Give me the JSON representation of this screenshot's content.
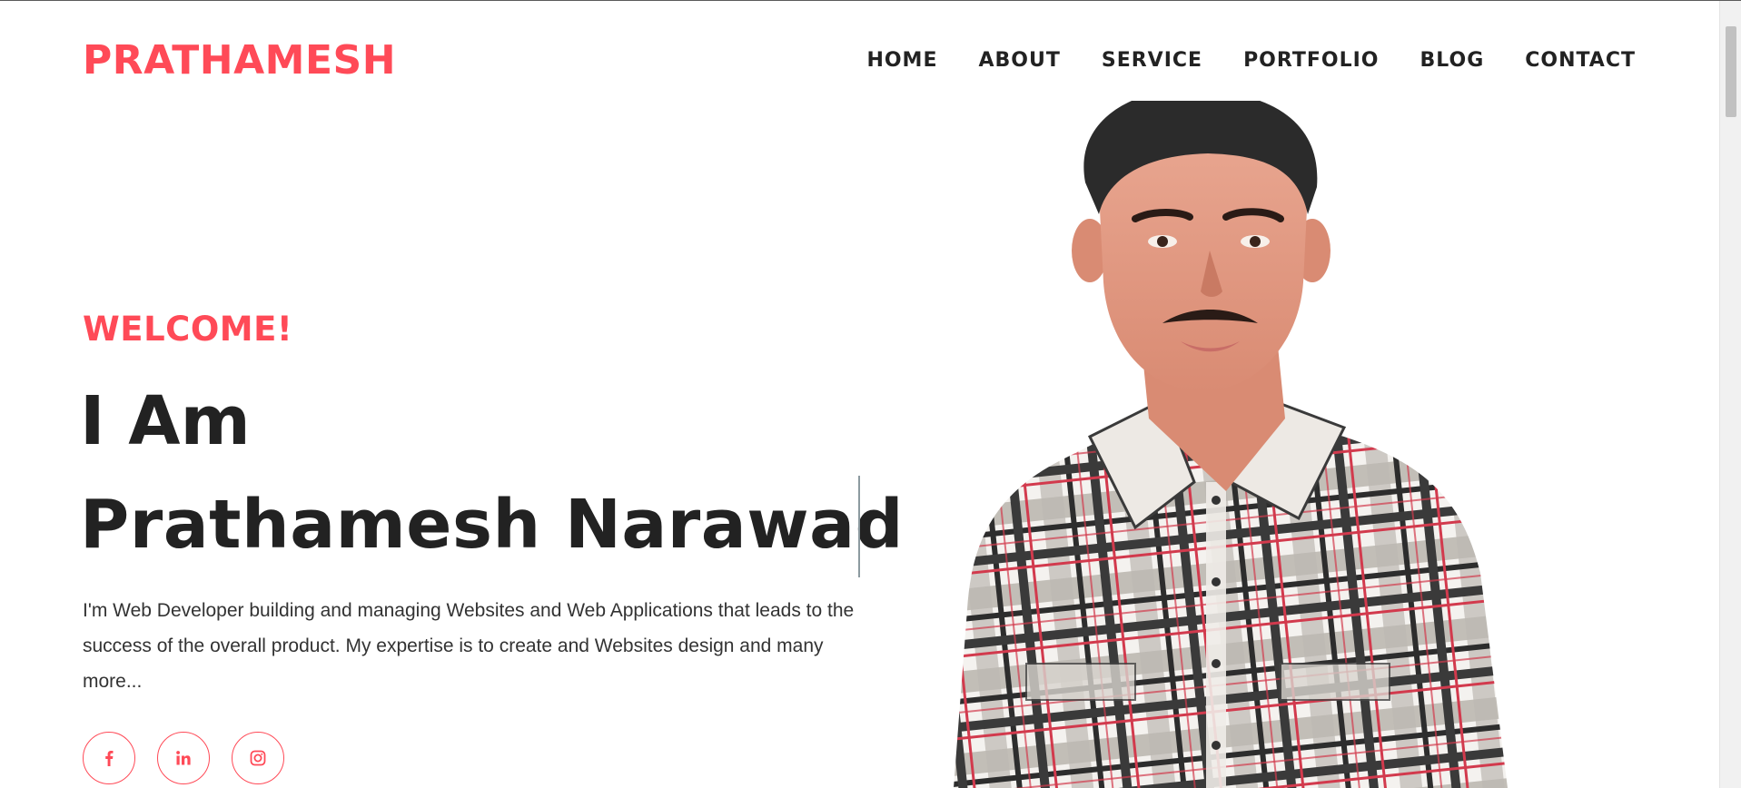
{
  "header": {
    "brand": "PRATHAMESH",
    "nav": [
      "HOME",
      "ABOUT",
      "SERVICE",
      "PORTFOLIO",
      "BLOG",
      "CONTACT"
    ]
  },
  "hero": {
    "welcome": "WELCOME!",
    "title_line1": "I Am",
    "title_line2": "Prathamesh Narawad",
    "description": "I'm Web Developer building and managing Websites and Web Applications that leads to the success of the overall product. My expertise is to create and Websites design and many more...",
    "socials": [
      "facebook-icon",
      "linkedin-icon",
      "instagram-icon"
    ]
  },
  "colors": {
    "accent": "#ff4a57",
    "text": "#222222"
  }
}
